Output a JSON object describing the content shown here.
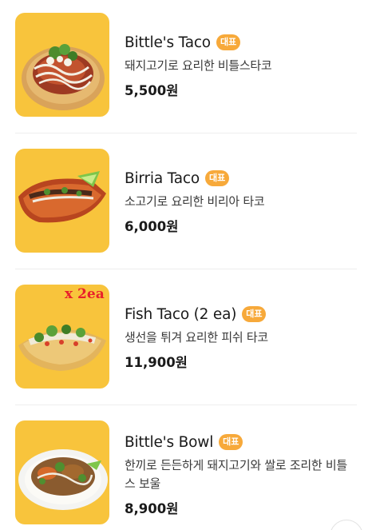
{
  "menu": {
    "items": [
      {
        "name": "Bittle's Taco",
        "badge": "대표",
        "description": "돼지고기로 요리한 비틀스타코",
        "price": "5,500원",
        "image": "taco-photo"
      },
      {
        "name": "Birria Taco",
        "badge": "대표",
        "description": "소고기로 요리한 비리아 타코",
        "price": "6,000원",
        "image": "birria-taco-photo"
      },
      {
        "name": "Fish Taco (2 ea)",
        "badge": "대표",
        "description": "생선을 튀겨 요리한 피쉬 타코",
        "price": "11,900원",
        "image": "fish-taco-photo",
        "overlay_text": "x 2ea"
      },
      {
        "name": "Bittle's Bowl",
        "badge": "대표",
        "description": "한끼로 든든하게 돼지고기와 쌀로 조리한 비틀스 보울",
        "price": "8,900원",
        "image": "bowl-photo"
      }
    ]
  },
  "colors": {
    "badge": "#f7a93a",
    "thumbnail_background": "#f8c43c",
    "overlay_text": "#e8202a"
  }
}
